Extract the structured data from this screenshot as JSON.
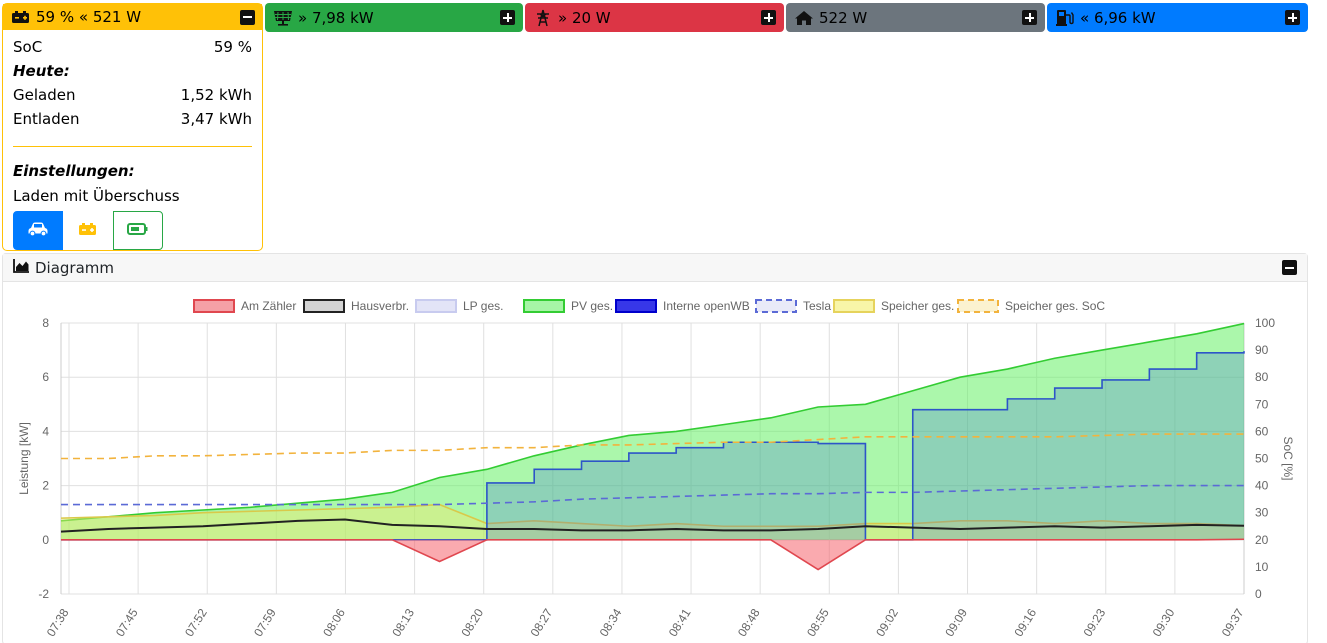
{
  "cards": {
    "speicher": {
      "header": "59 % « 521 W",
      "soc_label": "SoC",
      "soc_value": "59 %",
      "today_label": "Heute:",
      "charged_label": "Geladen",
      "charged_value": "1,52 kWh",
      "discharged_label": "Entladen",
      "discharged_value": "3,47 kWh",
      "settings_label": "Einstellungen:",
      "mode_label": "Laden mit Überschuss",
      "icons": [
        "battery-car-icon",
        "car-icon",
        "battery-icon",
        "battery-empty-icon"
      ]
    },
    "pv": {
      "header": "» 7,98 kW",
      "icon": "solar-panel-icon"
    },
    "evu": {
      "header": "» 20 W",
      "icon": "power-pylon-icon"
    },
    "haus": {
      "header": "522 W",
      "icon": "home-icon"
    },
    "lp": {
      "header": "« 6,96 kW",
      "icon": "charging-station-icon"
    }
  },
  "diagram": {
    "title": "Diagramm",
    "icon": "area-chart-icon"
  },
  "chart_data": {
    "type": "line",
    "legend_position": "top",
    "grid": true,
    "ylabel": "Leistung [kW]",
    "y2label": "SoC [%]",
    "ylim": [
      -2,
      8
    ],
    "y2lim": [
      0,
      100
    ],
    "yticks": [
      "8",
      "6",
      "4",
      "2",
      "0",
      "-2"
    ],
    "y2ticks": [
      "100",
      "90",
      "80",
      "70",
      "60",
      "50",
      "40",
      "30",
      "20",
      "10",
      "0"
    ],
    "xticks": [
      "07:38",
      "07:45",
      "07:52",
      "07:59",
      "08:06",
      "08:13",
      "08:20",
      "08:27",
      "08:34",
      "08:41",
      "08:48",
      "08:55",
      "09:02",
      "09:09",
      "09:16",
      "09:23",
      "09:30",
      "09:37"
    ],
    "legend": [
      {
        "name": "Am Zähler",
        "fill": "#f5a0a6",
        "stroke": "#e0474f",
        "dash": false
      },
      {
        "name": "Hausverbr.",
        "fill": "#d3d3d3",
        "stroke": "#222222",
        "dash": false
      },
      {
        "name": "LP ges.",
        "fill": "#e3e4f7",
        "stroke": "#c8cbef",
        "dash": false
      },
      {
        "name": "PV ges.",
        "fill": "#a6f5a6",
        "stroke": "#33cc33",
        "dash": false
      },
      {
        "name": "Interne openWB",
        "fill": "#3737e8",
        "stroke": "#0000cc",
        "dash": false
      },
      {
        "name": "Tesla",
        "fill": "#e9eaf8",
        "stroke": "#5b6ad6",
        "dash": true
      },
      {
        "name": "Speicher ges.",
        "fill": "#f8f5a8",
        "stroke": "#e6d35c",
        "dash": false
      },
      {
        "name": "Speicher ges. SoC",
        "fill": "#fbf2d0",
        "stroke": "#f2b33d",
        "dash": true
      }
    ],
    "series": [
      {
        "name": "PV ges.",
        "axis": "left",
        "unit": "kW",
        "values": [
          0.7,
          0.85,
          1.0,
          1.1,
          1.2,
          1.35,
          1.5,
          1.75,
          2.3,
          2.6,
          3.1,
          3.5,
          3.85,
          4.0,
          4.25,
          4.5,
          4.9,
          5.0,
          5.5,
          6.0,
          6.3,
          6.7,
          7.0,
          7.3,
          7.6,
          7.98
        ]
      },
      {
        "name": "Interne openWB",
        "axis": "left",
        "unit": "kW",
        "values": [
          0,
          0,
          0,
          0,
          0,
          0,
          0,
          0,
          0,
          2.1,
          2.6,
          2.9,
          3.2,
          3.4,
          3.6,
          3.6,
          3.55,
          0,
          4.8,
          4.8,
          5.2,
          5.6,
          5.9,
          6.3,
          6.9,
          6.96
        ]
      },
      {
        "name": "Hausverbr.",
        "axis": "left",
        "unit": "kW",
        "values": [
          0.3,
          0.4,
          0.45,
          0.5,
          0.6,
          0.7,
          0.75,
          0.55,
          0.5,
          0.4,
          0.4,
          0.35,
          0.35,
          0.4,
          0.35,
          0.35,
          0.4,
          0.5,
          0.45,
          0.4,
          0.45,
          0.5,
          0.45,
          0.5,
          0.55,
          0.52
        ]
      },
      {
        "name": "Am Zähler",
        "axis": "left",
        "unit": "kW",
        "values": [
          0,
          0,
          0,
          0,
          0,
          0,
          0,
          0,
          -0.8,
          0,
          0,
          0,
          0,
          0,
          0,
          0,
          -1.1,
          0,
          0,
          0,
          0,
          0,
          0,
          0,
          0,
          0.02
        ]
      },
      {
        "name": "Speicher ges.",
        "axis": "left",
        "unit": "kW",
        "values": [
          0.8,
          0.85,
          0.9,
          1.0,
          1.05,
          1.1,
          1.15,
          1.2,
          1.3,
          0.6,
          0.7,
          0.6,
          0.5,
          0.6,
          0.5,
          0.5,
          0.5,
          0.6,
          0.6,
          0.7,
          0.7,
          0.6,
          0.7,
          0.6,
          0.6,
          0.52
        ]
      },
      {
        "name": "Tesla",
        "axis": "left",
        "unit": "kW",
        "values": [
          1.3,
          1.3,
          1.3,
          1.3,
          1.3,
          1.3,
          1.3,
          1.3,
          1.3,
          1.35,
          1.4,
          1.5,
          1.55,
          1.6,
          1.65,
          1.7,
          1.7,
          1.75,
          1.75,
          1.8,
          1.85,
          1.9,
          1.95,
          2.0,
          2.0,
          2.0
        ]
      },
      {
        "name": "Speicher ges. SoC",
        "axis": "right",
        "unit": "%",
        "values": [
          50,
          50,
          51,
          51,
          51.5,
          52,
          52,
          53,
          53,
          54,
          54,
          55,
          55,
          55.5,
          56,
          56,
          57,
          58,
          58,
          58,
          58,
          58,
          58.5,
          59,
          59,
          59
        ]
      }
    ]
  }
}
